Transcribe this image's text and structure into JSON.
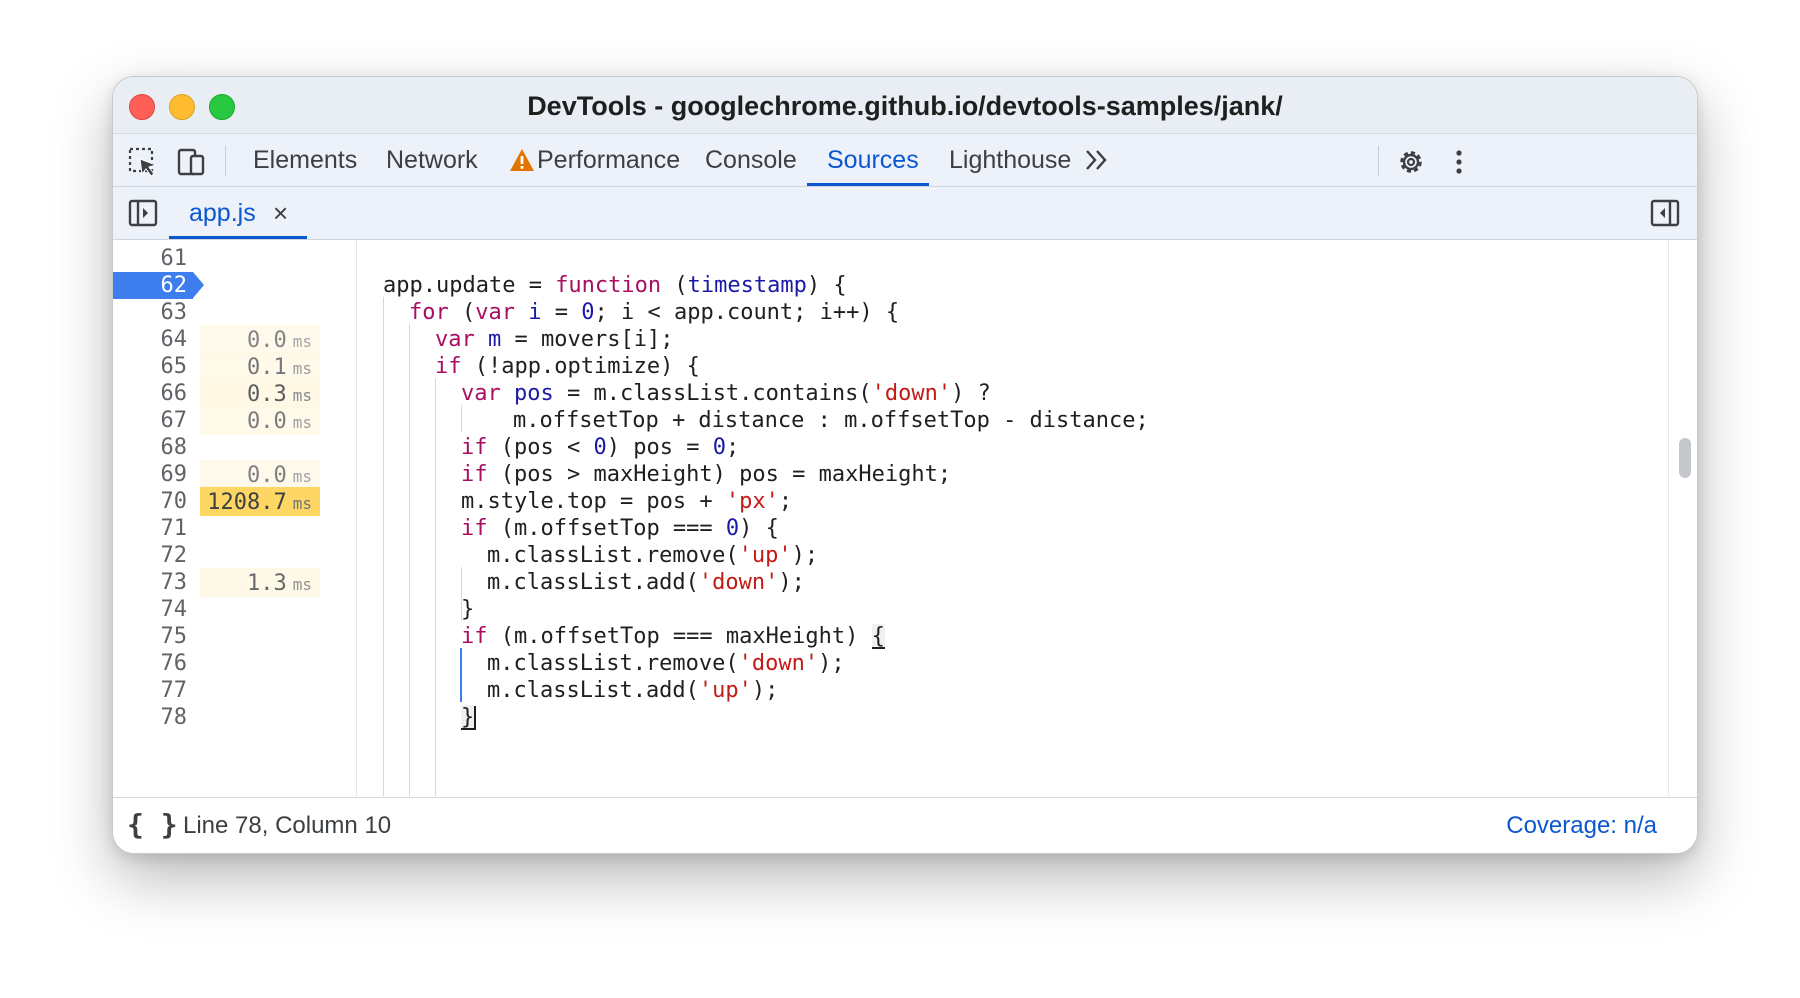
{
  "window": {
    "title": "DevTools - googlechrome.github.io/devtools-samples/jank/"
  },
  "toolbar": {
    "tabs": [
      "Elements",
      "Network",
      "Performance",
      "Console",
      "Sources",
      "Lighthouse"
    ],
    "active_tab": "Sources",
    "more_label": "»",
    "icons": [
      "inspect-element-icon",
      "device-toolbar-icon",
      "warning-icon",
      "chevron-double-right-icon",
      "gear-icon",
      "kebab-menu-icon"
    ]
  },
  "file_tabs": {
    "name": "app.js",
    "close_label": "×"
  },
  "editor": {
    "current_line": "62",
    "lines": [
      {
        "n": "61",
        "t": "",
        "ms": ""
      },
      {
        "n": "62",
        "t": "",
        "ms": ""
      },
      {
        "n": "63",
        "t": "",
        "ms": ""
      },
      {
        "n": "64",
        "t": "0.0",
        "ms": "ms"
      },
      {
        "n": "65",
        "t": "0.1",
        "ms": "ms"
      },
      {
        "n": "66",
        "t": "0.3",
        "ms": "ms"
      },
      {
        "n": "67",
        "t": "0.0",
        "ms": "ms"
      },
      {
        "n": "68",
        "t": "",
        "ms": ""
      },
      {
        "n": "69",
        "t": "0.0",
        "ms": "ms"
      },
      {
        "n": "70",
        "t": "1208.7",
        "ms": "ms"
      },
      {
        "n": "71",
        "t": "",
        "ms": ""
      },
      {
        "n": "72",
        "t": "",
        "ms": ""
      },
      {
        "n": "73",
        "t": "1.3",
        "ms": "ms"
      },
      {
        "n": "74",
        "t": "",
        "ms": ""
      },
      {
        "n": "75",
        "t": "",
        "ms": ""
      },
      {
        "n": "76",
        "t": "",
        "ms": ""
      },
      {
        "n": "77",
        "t": "",
        "ms": ""
      },
      {
        "n": "78",
        "t": "",
        "ms": ""
      }
    ],
    "code": {
      "l62a": "app.update = ",
      "l62kw": "function",
      "l62b": " (",
      "l62id": "timestamp",
      "l62c": ") {",
      "l63kw": "for",
      "l63b": " (",
      "l63kw2": "var",
      "l63c": " ",
      "l63id": "i",
      "l63d": " = ",
      "l63num": "0",
      "l63e": "; i < app.count; i++) {",
      "l64kw": "var",
      "l64a": " ",
      "l64id": "m",
      "l64b": " = movers[i];",
      "l65kw": "if",
      "l65a": " (!app.optimize) {",
      "l66kw": "var",
      "l66a": " ",
      "l66id": "pos",
      "l66b": " = m.classList.contains(",
      "l66str": "'down'",
      "l66c": ") ?",
      "l67": "m.offsetTop + distance : m.offsetTop - distance;",
      "l68kw": "if",
      "l68a": " (pos < ",
      "l68num": "0",
      "l68b": ") pos = ",
      "l68num2": "0",
      "l68c": ";",
      "l69kw": "if",
      "l69a": " (pos > maxHeight) pos = maxHeight;",
      "l70a": "m.style.top = pos + ",
      "l70str": "'px'",
      "l70b": ";",
      "l71kw": "if",
      "l71a": " (m.offsetTop === ",
      "l71num": "0",
      "l71b": ") {",
      "l72a": "m.classList.remove(",
      "l72str": "'up'",
      "l72b": ");",
      "l73a": "m.classList.add(",
      "l73str": "'down'",
      "l73b": ");",
      "l74": "}",
      "l75kw": "if",
      "l75a": " (m.offsetTop === maxHeight) ",
      "l75br": "{",
      "l76a": "m.classList.remove(",
      "l76str": "'down'",
      "l76b": ");",
      "l77a": "m.classList.add(",
      "l77str": "'up'",
      "l77b": ");",
      "l78": "}"
    }
  },
  "status": {
    "pretty_print_label": "{ }",
    "position": "Line 78, Column 10",
    "coverage": "Coverage: n/a"
  },
  "colors": {
    "accent": "#0b57d0",
    "breakpoint": "#3d7ded",
    "timing_light": "#fef7e0",
    "timing_hot": "#fdd663",
    "keyword": "#a80f60",
    "string": "#c41a16",
    "number": "#1a1aa6"
  }
}
